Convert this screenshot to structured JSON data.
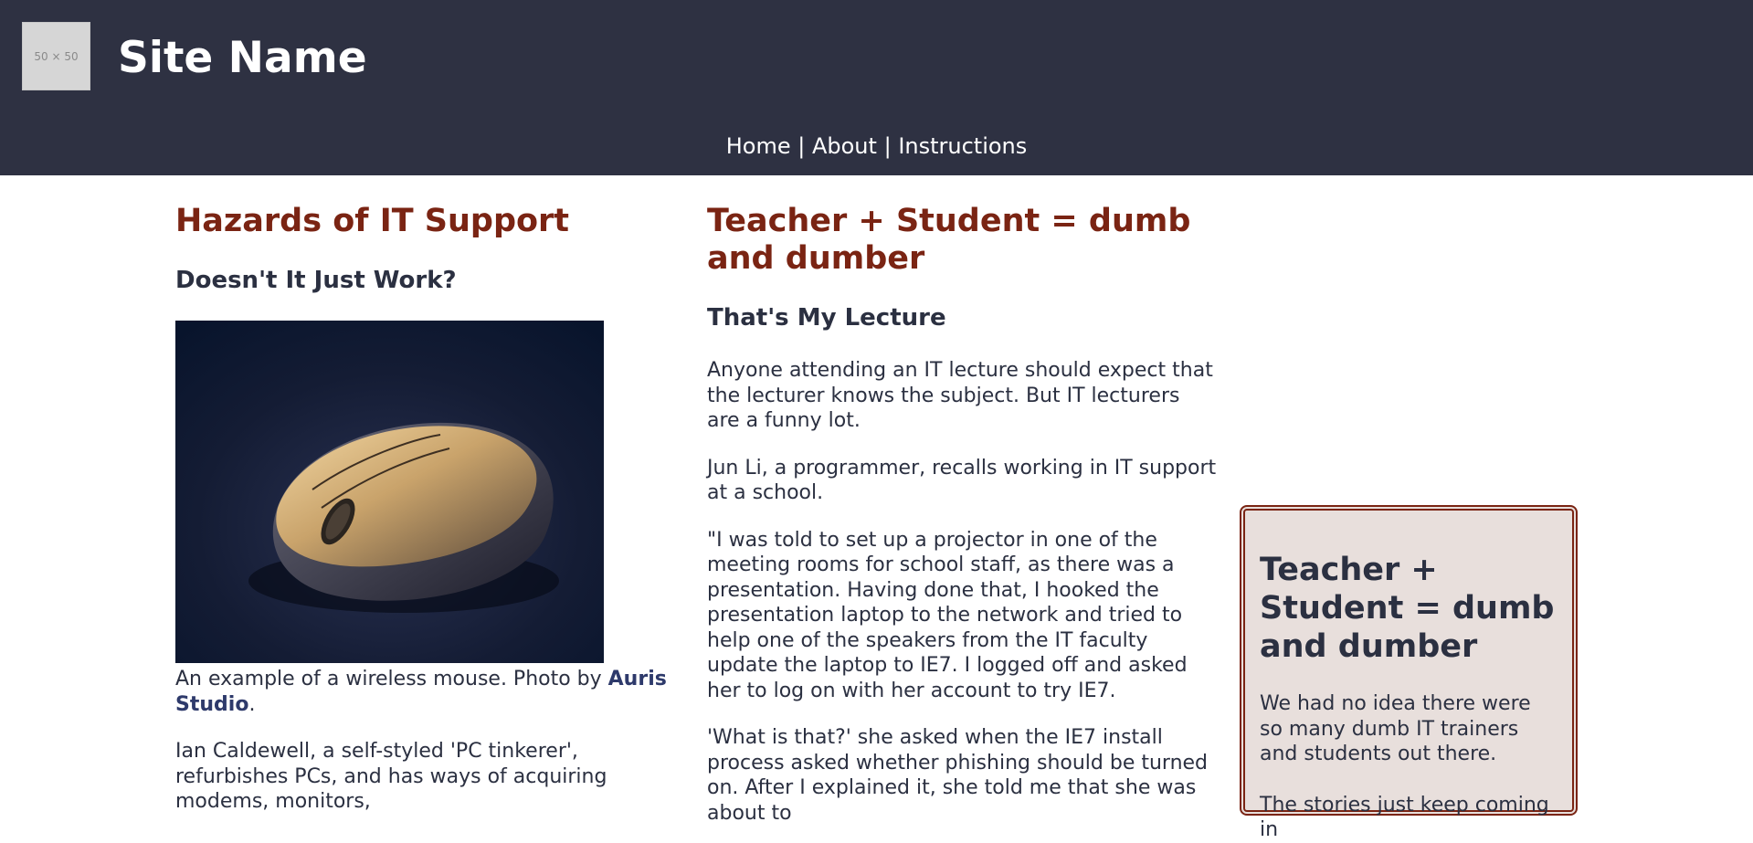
{
  "header": {
    "logo_text": "50 × 50",
    "site_name": "Site Name",
    "nav": {
      "home": "Home",
      "separator": "|",
      "about": "About",
      "instructions": "Instructions"
    }
  },
  "article1": {
    "title": "Hazards of IT Support",
    "subtitle": "Doesn't It Just Work?",
    "image_alt": "wireless mouse photo",
    "caption_prefix": "An example of a wireless mouse. Photo by ",
    "caption_credit": "Auris Studio",
    "caption_suffix": ".",
    "paragraph1": "Ian Caldewell, a self-styled 'PC tinkerer', refurbishes PCs, and has ways of acquiring modems, monitors,"
  },
  "article2": {
    "title": "Teacher + Student = dumb and dumber",
    "subtitle": "That's My Lecture",
    "paragraphs": [
      "Anyone attending an IT lecture should expect that the lecturer knows the subject. But IT lecturers are a funny lot.",
      "Jun Li, a programmer, recalls working in IT support at a school.",
      "\"I was told to set up a projector in one of the meeting rooms for school staff, as there was a presentation. Having done that, I hooked the presentation laptop to the network and tried to help one of the speakers from the IT faculty update the laptop to IE7. I logged off and asked her to log on with her account to try IE7.",
      "'What is that?' she asked when the IE7 install process asked whether phishing should be turned on. After I explained it, she told me that she was about to"
    ]
  },
  "aside": {
    "title": "Teacher + Student = dumb and dumber",
    "paragraph1": "We had no idea there were so many dumb IT trainers and students out there.",
    "paragraph2": "The stories just keep coming in"
  }
}
